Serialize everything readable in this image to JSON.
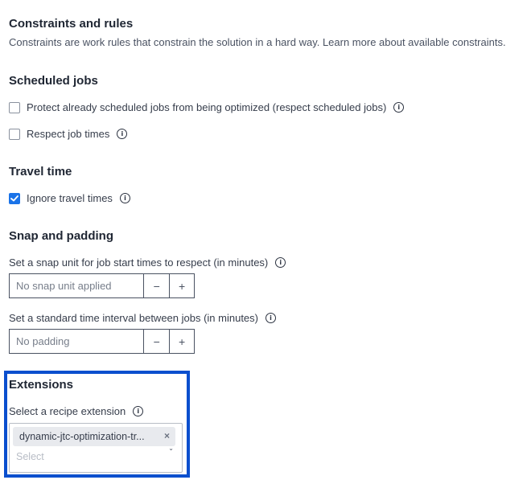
{
  "constraints": {
    "title": "Constraints and rules",
    "description": "Constraints are work rules that constrain the solution in a hard way. Learn more about available constraints."
  },
  "scheduled_jobs": {
    "title": "Scheduled jobs",
    "options": [
      {
        "label": "Protect already scheduled jobs from being optimized (respect scheduled jobs)",
        "checked": false,
        "info_icon": "info-icon"
      },
      {
        "label": "Respect job times",
        "checked": false,
        "info_icon": "info-icon"
      }
    ]
  },
  "travel_time": {
    "title": "Travel time",
    "options": [
      {
        "label": "Ignore travel times",
        "checked": true,
        "info_icon": "info-icon"
      }
    ]
  },
  "snap_padding": {
    "title": "Snap and padding",
    "snap": {
      "label": "Set a snap unit for job start times to respect (in minutes)",
      "placeholder": "No snap unit applied",
      "decrement": "−",
      "increment": "+"
    },
    "padding": {
      "label": "Set a standard time interval between jobs (in minutes)",
      "placeholder": "No padding",
      "decrement": "−",
      "increment": "+"
    }
  },
  "extensions": {
    "title": "Extensions",
    "label": "Select a recipe extension",
    "selected": [
      "dynamic-jtc-optimization-tr..."
    ],
    "remove_glyph": "×",
    "placeholder": "Select",
    "caret_glyph": "⌄",
    "highlight_color": "#0a4fce"
  },
  "icons": {
    "info": "i",
    "check": "✓"
  }
}
